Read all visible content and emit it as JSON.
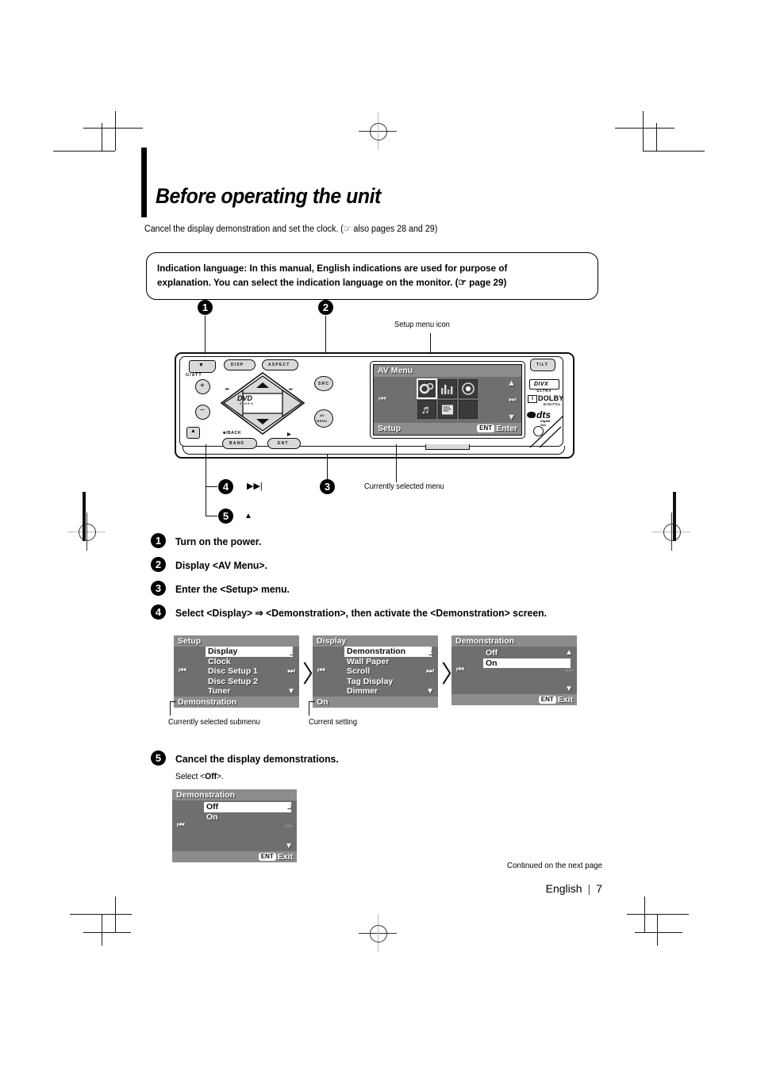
{
  "page": {
    "title": "Before operating the unit",
    "intro": "Cancel the display demonstration and set the clock. (☞ also pages 28 and 29)",
    "note": "Indication language: In this manual, English indications are used for purpose of explanation. You can select the indication language on the monitor. (☞ page 29)",
    "continued": "Continued on the next page",
    "language": "English",
    "separator": "|",
    "page_number": "7"
  },
  "callouts": {
    "one": "1",
    "two": "2",
    "three": "3",
    "four": "4",
    "five": "5",
    "setup_menu_icon": "Setup menu icon",
    "currently_selected_menu": "Currently selected menu",
    "currently_selected_submenu": "Currently selected submenu",
    "current_setting": "Current setting",
    "step4_symbol": "▶▶|",
    "step5_symbol": "▲"
  },
  "steps": [
    {
      "num": "1",
      "text": "Turn on the power."
    },
    {
      "num": "2",
      "text": "Display <AV Menu>."
    },
    {
      "num": "3",
      "text": "Enter the <Setup> menu."
    },
    {
      "num": "4",
      "text": "Select <Display> ⇒ <Demonstration>, then activate the <Demonstration> screen."
    }
  ],
  "step5": {
    "num": "5",
    "text": "Cancel the display demonstrations.",
    "sub_prefix": "Select <",
    "sub_bold": "Off",
    "sub_suffix": ">."
  },
  "device": {
    "buttons": {
      "power_att": "/ATT",
      "disp": "DISP",
      "aspect": "ASPECT",
      "tilt": "TILT",
      "src": "SRC",
      "av_menu_line1": "AV",
      "av_menu_line2": "MENU",
      "band": "BAND",
      "ent": "ENT",
      "back": "■/BACK",
      "play": "▶",
      "plus": "+",
      "minus": "−",
      "eject": "▲",
      "disc_label": "DVD",
      "disc_sub": "VIDEO"
    },
    "logos": [
      {
        "name": "DivX",
        "main": "DIVX",
        "sub": "ULTRA"
      },
      {
        "name": "Dolby",
        "main": "DOLBY",
        "sub": "DIGITAL"
      },
      {
        "name": "dts",
        "main": "dts",
        "sub": "Digital Out"
      }
    ]
  },
  "av_menu_screen": {
    "title": "AV Menu",
    "footer_left": "Setup",
    "footer_badge": "ENT",
    "footer_right": "Enter",
    "prev": "⏮",
    "next": "⏭",
    "up": "▲",
    "down": "▼",
    "icons": [
      {
        "name": "setup-gears-icon",
        "glyph": "⚙",
        "selected": true
      },
      {
        "name": "equalizer-icon",
        "glyph": "☰",
        "selected": false
      },
      {
        "name": "speaker-icon",
        "glyph": "◉",
        "selected": false
      },
      {
        "name": "music-note-icon",
        "glyph": "♫",
        "selected": false
      },
      {
        "name": "list-icon",
        "glyph": "≡",
        "selected": false
      },
      {
        "name": "blank-icon",
        "glyph": "",
        "selected": false
      }
    ]
  },
  "panels": [
    {
      "id": "setup",
      "title": "Setup",
      "items": [
        "Display",
        "Clock",
        "Disc Setup 1",
        "Disc Setup 2",
        "Tuner"
      ],
      "highlight_index": 0,
      "footer_left": "Demonstration",
      "footer_badge": "",
      "footer_right": "",
      "prev": "⏮",
      "next": "⏭",
      "next_dim": false,
      "up": "▲",
      "down": "▼"
    },
    {
      "id": "display",
      "title": "Display",
      "items": [
        "Demonstration",
        "Wall Paper",
        "Scroll",
        "Tag Display",
        "Dimmer"
      ],
      "highlight_index": 0,
      "footer_left": "On",
      "footer_badge": "",
      "footer_right": "",
      "prev": "⏮",
      "next": "⏭",
      "next_dim": false,
      "up": "▲",
      "down": "▼"
    },
    {
      "id": "demonstration-on",
      "title": "Demonstration",
      "items": [
        "Off",
        "On"
      ],
      "highlight_index": 1,
      "footer_left": "",
      "footer_badge": "ENT",
      "footer_right": "Exit",
      "prev": "⏮",
      "next": "⏭",
      "next_dim": true,
      "up": "▲",
      "down": "▼"
    }
  ],
  "panel_final": {
    "id": "demonstration-off",
    "title": "Demonstration",
    "items": [
      "Off",
      "On"
    ],
    "highlight_index": 0,
    "footer_left": "",
    "footer_badge": "ENT",
    "footer_right": "Exit",
    "prev": "⏮",
    "next": "⏭",
    "next_dim": true,
    "up": "▲",
    "down": "▼"
  },
  "colors": {
    "panel_body": "#6f6f6f",
    "panel_bar": "#8c8c8c",
    "highlight_bg": "#ffffff",
    "ink": "#000000"
  }
}
